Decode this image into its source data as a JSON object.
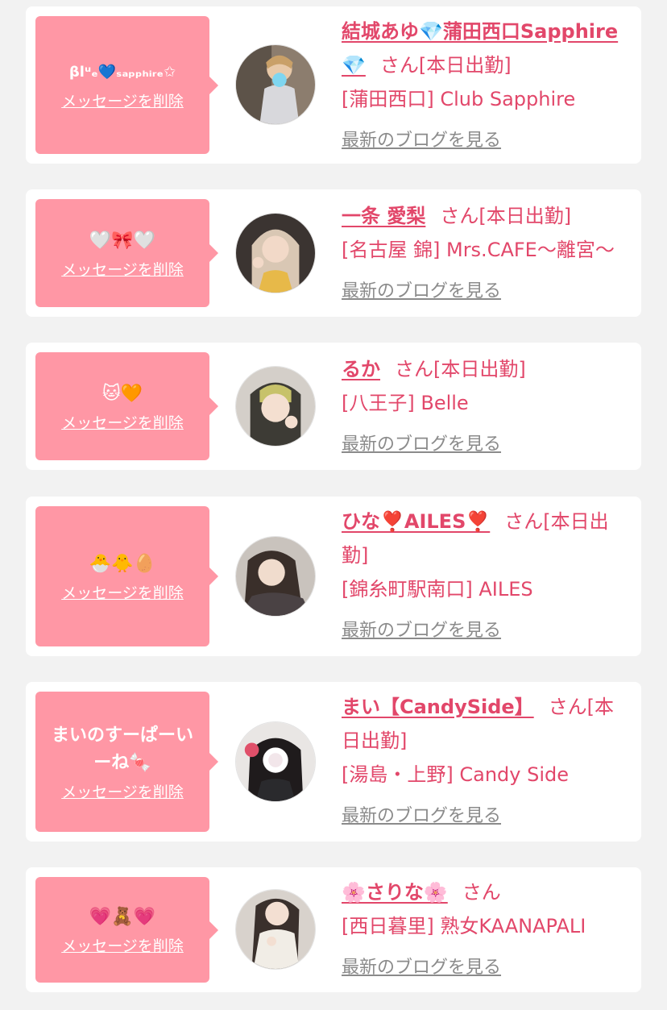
{
  "colors": {
    "accent": "#e2476a",
    "bubble": "#ff97a5",
    "link_gray": "#8b8b8b",
    "background": "#f2f2f2"
  },
  "entries": [
    {
      "message": "βlᵘₑ💙ₛₐₚₚₕᵢᵣₑ✩",
      "delete_label": "メッセージを削除",
      "name": "結城あゆ💎蒲田西口Sapphire💎",
      "suffix": "さん[本日出勤]",
      "shop": "[蒲田西口] Club Sapphire",
      "blog_label": "最新のブログを見る"
    },
    {
      "message": "🤍🎀🤍",
      "delete_label": "メッセージを削除",
      "name": "一条 愛梨",
      "suffix": "さん[本日出勤]",
      "shop": "[名古屋 錦] Mrs.CAFE〜離宮〜",
      "blog_label": "最新のブログを見る"
    },
    {
      "message": "🐱🧡",
      "delete_label": "メッセージを削除",
      "name": "るか",
      "suffix": "さん[本日出勤]",
      "shop": "[八王子] Belle",
      "blog_label": "最新のブログを見る"
    },
    {
      "message": "🐣🐥🥚",
      "delete_label": "メッセージを削除",
      "name": "ひな❣️AILES❣️",
      "suffix": "さん[本日出勤]",
      "shop": "[錦糸町駅南口] AILES",
      "blog_label": "最新のブログを見る"
    },
    {
      "message": "まいのすーぱーいーね🍬",
      "delete_label": "メッセージを削除",
      "name": "まい【CandySide】",
      "suffix": "さん[本日出勤]",
      "shop": "[湯島・上野] Candy Side",
      "blog_label": "最新のブログを見る"
    },
    {
      "message": "💗🧸💗",
      "delete_label": "メッセージを削除",
      "name": "🌸さりな🌸",
      "suffix": "さん",
      "shop": "[西日暮里] 熟女KAANAPALI",
      "blog_label": "最新のブログを見る"
    }
  ]
}
